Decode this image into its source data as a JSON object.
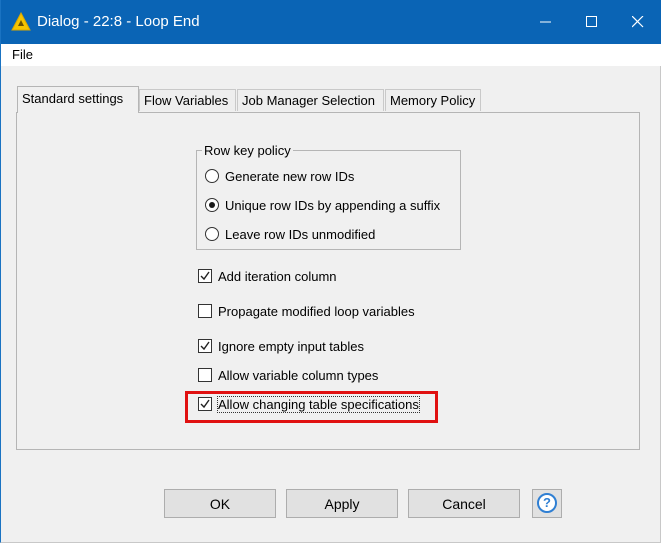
{
  "window": {
    "title": "Dialog - 22:8 - Loop End",
    "colors": {
      "titlebar": "#0a64b5",
      "highlight": "#e01010"
    },
    "icons": [
      "knime-warning-triangle-icon",
      "minimize-icon",
      "maximize-icon",
      "close-icon"
    ]
  },
  "menu": {
    "file": "File"
  },
  "tabs": [
    {
      "label": "Standard settings",
      "active": true
    },
    {
      "label": "Flow Variables",
      "active": false
    },
    {
      "label": "Job Manager Selection",
      "active": false
    },
    {
      "label": "Memory Policy",
      "active": false
    }
  ],
  "row_key_policy": {
    "legend": "Row key policy",
    "options": [
      {
        "label": "Generate new row IDs",
        "selected": false
      },
      {
        "label": "Unique row IDs by appending a suffix",
        "selected": true
      },
      {
        "label": "Leave row IDs unmodified",
        "selected": false
      }
    ]
  },
  "checkboxes": [
    {
      "label": "Add iteration column",
      "checked": true
    },
    {
      "label": "Propagate modified loop variables",
      "checked": false
    },
    {
      "label": "Ignore empty input tables",
      "checked": true
    },
    {
      "label": "Allow variable column types",
      "checked": false
    },
    {
      "label": "Allow changing table specifications",
      "checked": true
    }
  ],
  "buttons": {
    "ok": "OK",
    "apply": "Apply",
    "cancel": "Cancel",
    "help": "?"
  }
}
